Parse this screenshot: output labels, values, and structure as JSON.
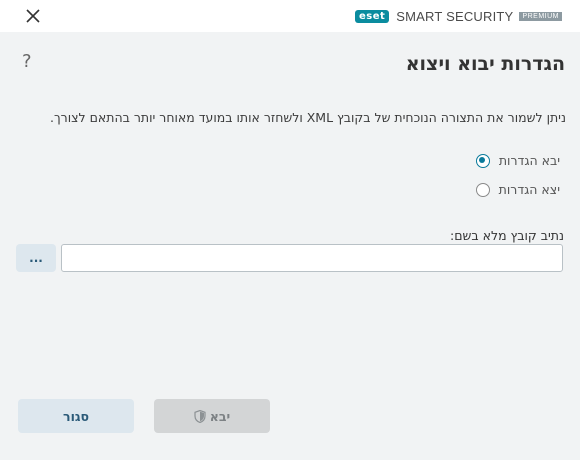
{
  "brand": {
    "logo": "eset",
    "product": "SMART SECURITY",
    "tier": "PREMIUM"
  },
  "dialog": {
    "title": "הגדרות יבוא ויצוא",
    "help": "?",
    "description": "ניתן לשמור את התצורה הנוכחית של בקובץ XML ולשחזר אותו במועד מאוחר יותר בהתאם לצורך.",
    "options": [
      {
        "label": "יבא הגדרות",
        "checked": true
      },
      {
        "label": "יצא הגדרות",
        "checked": false
      }
    ],
    "path_label": "נתיב קובץ מלא בשם:",
    "path_value": "",
    "browse_label": "...",
    "import_label": "יבא",
    "close_label": "סגור"
  },
  "colors": {
    "accent": "#0a7a9b",
    "eset_teal": "#0a8c9f",
    "button_bg": "#dde7ee",
    "disabled_bg": "#d3d5d6"
  }
}
